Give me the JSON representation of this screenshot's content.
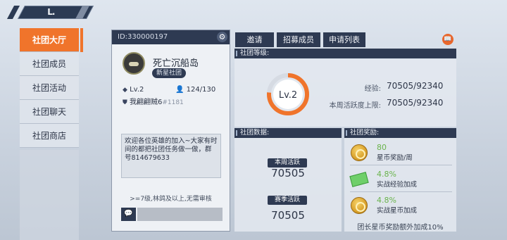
{
  "colors": {
    "accent": "#f0742b",
    "navy": "#2e3a52",
    "reward_green": "#6ab44c"
  },
  "top": {
    "back_label": "L."
  },
  "side_menu": [
    {
      "label": "社团大厅",
      "active": true
    },
    {
      "label": "社团成员",
      "active": false
    },
    {
      "label": "社团活动",
      "active": false
    },
    {
      "label": "社团聊天",
      "active": false
    },
    {
      "label": "社团商店",
      "active": false
    }
  ],
  "info": {
    "id_text": "ID:330000197",
    "guild_name": "死亡沉船岛",
    "badge": "新星社团",
    "level": "Lv.2",
    "members": "124/130",
    "leader": "我翩翩贼6",
    "leader_uid": "#1181",
    "notice": "欢迎各位英雄的加入~大家有时间的都把社团任务做一做，群号814679633",
    "rule": ">=7级,林鸽及以上,无需审核"
  },
  "tabs": [
    "邀请",
    "招募成员",
    "申请列表"
  ],
  "level_section": {
    "title": "社团等级:",
    "level_text": "Lv.2",
    "progress": 0.764,
    "exp_label": "经验:",
    "exp_value": "70505/92340",
    "weekly_label": "本周活跃度上限:",
    "weekly_value": "70505/92340"
  },
  "data_section": {
    "title": "社团数据:",
    "weekly_tag": "本周活跃",
    "weekly_value": "70505",
    "season_tag": "赛季活跃",
    "season_value": "70505"
  },
  "reward_section": {
    "title": "社团奖励:",
    "items": [
      {
        "icon": "coin-icon",
        "value": "80",
        "name": "星币奖励/周"
      },
      {
        "icon": "cash-icon",
        "value": "4.8%",
        "name": "实战经验加成"
      },
      {
        "icon": "coin-icon",
        "value": "4.8%",
        "name": "实战星币加成"
      }
    ],
    "bonus_note": "团长星币奖励额外加成10%"
  }
}
